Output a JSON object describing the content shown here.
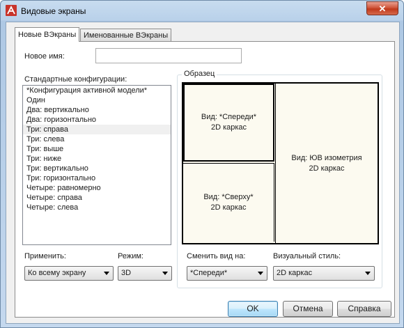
{
  "window": {
    "title": "Видовые экраны"
  },
  "tabs": [
    {
      "label": "Новые ВЭкраны"
    },
    {
      "label": "Именованные ВЭкраны"
    }
  ],
  "new_name": {
    "label": "Новое имя:",
    "value": ""
  },
  "standard": {
    "label": "Стандартные конфигурации:",
    "items": [
      "*Конфигурация активной модели*",
      "Один",
      "Два: вертикально",
      "Два: горизонтально",
      "Три: справа",
      "Три: слева",
      "Три: выше",
      "Три: ниже",
      "Три: вертикально",
      "Три: горизонтально",
      "Четыре: равномерно",
      "Четыре: справа",
      "Четыре: слева"
    ],
    "selected_index": 4
  },
  "preview": {
    "label": "Образец",
    "viewports": [
      {
        "line1": "Вид: *Спереди*",
        "line2": "2D каркас"
      },
      {
        "line1": "Вид: *Сверху*",
        "line2": "2D каркас"
      },
      {
        "line1": "Вид: ЮВ изометрия",
        "line2": "2D каркас"
      }
    ]
  },
  "apply": {
    "label": "Применить:",
    "value": "Ко всему экрану"
  },
  "mode": {
    "label": "Режим:",
    "value": "3D"
  },
  "change_view": {
    "label": "Сменить вид на:",
    "value": "*Спереди*"
  },
  "visual_style": {
    "label": "Визуальный стиль:",
    "value": "2D каркас"
  },
  "buttons": {
    "ok": "OK",
    "cancel": "Отмена",
    "help": "Справка"
  },
  "colors": {
    "preview_bg": "#fcfaf0",
    "selection": "#f0f0f0",
    "close": "#c0391b"
  }
}
